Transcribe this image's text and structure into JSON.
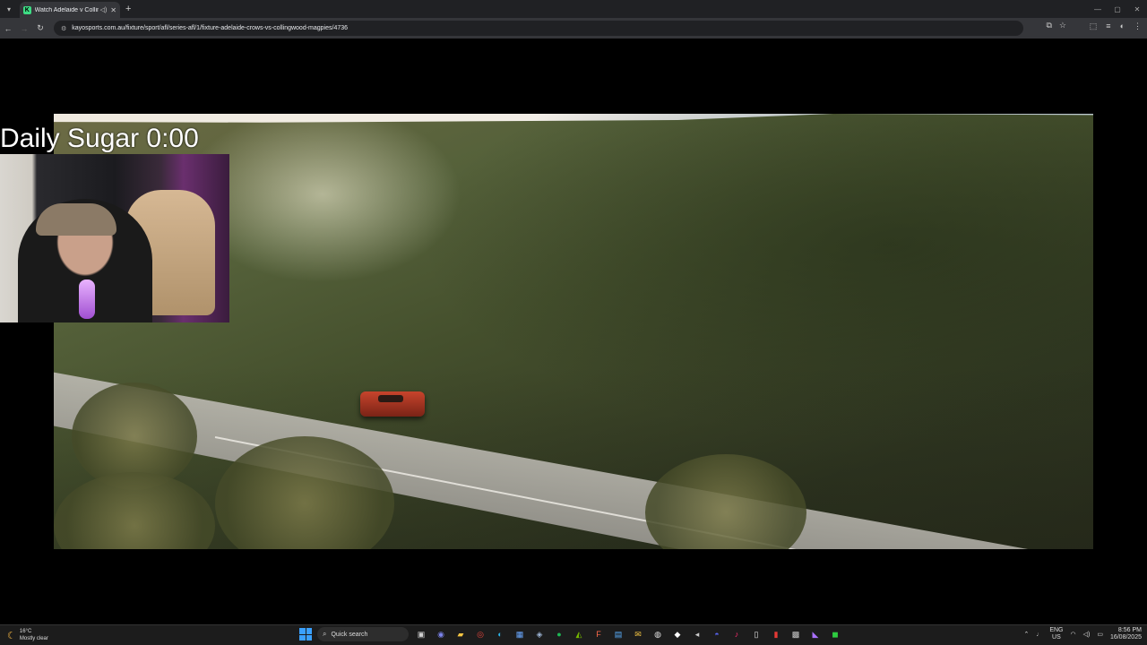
{
  "browser": {
    "tab_title": "Watch Adelaide v Collingwood",
    "favicon_letter": "K",
    "audio_icon": "speaker-icon",
    "new_tab": "+",
    "url": "kayosports.com.au/fixture/sport/afl/series-afl/1/fixture-adelaide-crows-vs-collingwood-magpies/4736",
    "window_controls": [
      "—",
      "▢",
      "✕"
    ]
  },
  "stream": {
    "overlay_title": "Daily Sugar 0:00"
  },
  "taskbar": {
    "weather_temp": "16°C",
    "weather_desc": "Mostly clear",
    "search_placeholder": "Quick search",
    "lang_top": "ENG",
    "lang_bottom": "US",
    "time": "8:56 PM",
    "date": "16/08/2025",
    "apps": [
      {
        "name": "file-explorer-icon",
        "glyph": "▣",
        "color": "#d0d0d0"
      },
      {
        "name": "copilot-icon",
        "glyph": "◉",
        "color": "#7b83eb"
      },
      {
        "name": "folder-icon",
        "glyph": "▰",
        "color": "#f5c542"
      },
      {
        "name": "chrome-icon",
        "glyph": "◎",
        "color": "#e8453c"
      },
      {
        "name": "edge-icon",
        "glyph": "◐",
        "color": "#2bb4e8"
      },
      {
        "name": "store-icon",
        "glyph": "▦",
        "color": "#6aa8ff"
      },
      {
        "name": "steam-icon",
        "glyph": "◈",
        "color": "#9fb6d6"
      },
      {
        "name": "spotify-icon",
        "glyph": "●",
        "color": "#1db954"
      },
      {
        "name": "nvidia-icon",
        "glyph": "◭",
        "color": "#76b900"
      },
      {
        "name": "fl-studio-icon",
        "glyph": "F",
        "color": "#ff6b4a"
      },
      {
        "name": "file-icon",
        "glyph": "▤",
        "color": "#5ab1ff"
      },
      {
        "name": "mail-icon",
        "glyph": "✉",
        "color": "#f5c542"
      },
      {
        "name": "obs-icon",
        "glyph": "◍",
        "color": "#e0e0e0"
      },
      {
        "name": "epic-icon",
        "glyph": "◆",
        "color": "#ffffff"
      },
      {
        "name": "arrow-icon",
        "glyph": "◂",
        "color": "#cccccc"
      },
      {
        "name": "discord-icon",
        "glyph": "◓",
        "color": "#5865f2"
      },
      {
        "name": "tiktok-icon",
        "glyph": "♪",
        "color": "#ff2d6f"
      },
      {
        "name": "notes-icon",
        "glyph": "▯",
        "color": "#e0e0e0"
      },
      {
        "name": "red-app-icon",
        "glyph": "▮",
        "color": "#e53935"
      },
      {
        "name": "calc-icon",
        "glyph": "▩",
        "color": "#cccccc"
      },
      {
        "name": "twitch-icon",
        "glyph": "◣",
        "color": "#a970ff"
      },
      {
        "name": "xbox-icon",
        "glyph": "◼",
        "color": "#2ecc40"
      }
    ]
  }
}
